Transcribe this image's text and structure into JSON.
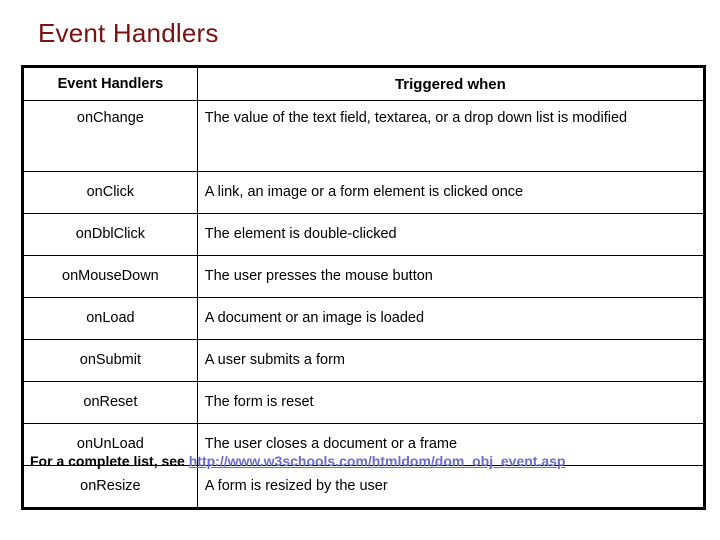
{
  "slide": {
    "title": "Event Handlers",
    "title_color": "#7B1113",
    "background_color": "#ffffff"
  },
  "table": {
    "headers": {
      "event": "Event Handlers",
      "description": "Triggered when"
    },
    "rows": [
      {
        "event": "onChange",
        "description": "The value of the text field, textarea, or a drop down list is modified"
      },
      {
        "event": "onClick",
        "description": "A link, an image or a form element is clicked once"
      },
      {
        "event": "onDblClick",
        "description": "The element is double-clicked"
      },
      {
        "event": "onMouseDown",
        "description": "The user presses the mouse button"
      },
      {
        "event": "onLoad",
        "description": "A document or an image is loaded"
      },
      {
        "event": "onSubmit",
        "description": "A user submits a form"
      },
      {
        "event": "onReset",
        "description": "The form is reset"
      },
      {
        "event": "onUnLoad",
        "description": "The user closes a document or a frame"
      },
      {
        "event": "onResize",
        "description": "A form is resized by the user"
      }
    ]
  },
  "footer": {
    "prefix": "For a complete list, see ",
    "link_text": "http://www.w3schools.com/htmldom/dom_obj_event.asp",
    "link_color": "#6B6BCF"
  }
}
